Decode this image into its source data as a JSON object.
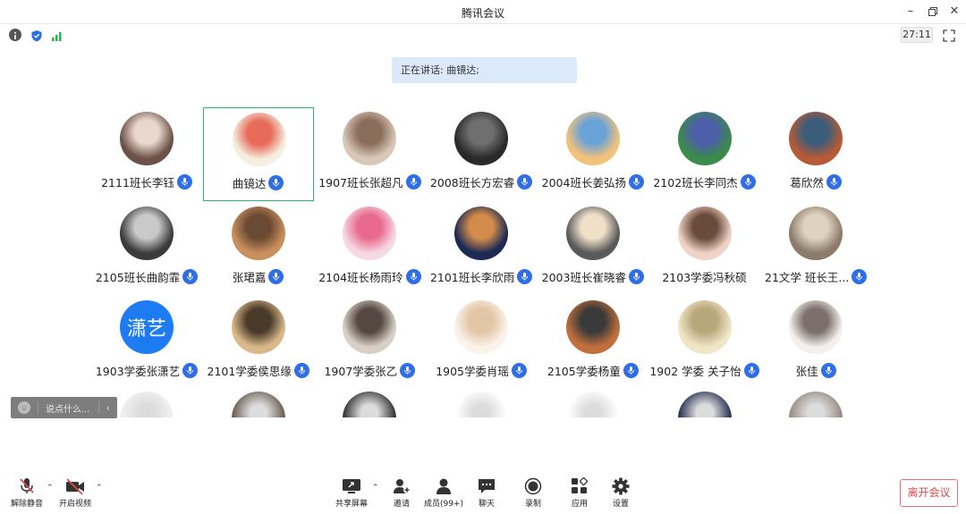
{
  "window": {
    "title": "腾讯会议",
    "minimize_icon": "minimize-icon",
    "restore_icon": "restore-icon",
    "close_icon": "close-icon"
  },
  "infobar": {
    "timer": "27:11",
    "icons": [
      "info-icon",
      "shield-icon",
      "signal-icon",
      "fullscreen-icon"
    ]
  },
  "speaking": {
    "text": "正在讲话: 曲镜达;"
  },
  "participants": [
    {
      "name": "2111班长李钰",
      "mic": true
    },
    {
      "name": "曲镜达",
      "mic": true,
      "active": true
    },
    {
      "name": "1907班长张超凡",
      "mic": true
    },
    {
      "name": "2008班长方宏睿",
      "mic": true
    },
    {
      "name": "2004班长姜弘扬",
      "mic": true
    },
    {
      "name": "2102班长李同杰",
      "mic": true
    },
    {
      "name": "葛欣然",
      "mic": true
    },
    {
      "name": "2105班长曲韵霏",
      "mic": true
    },
    {
      "name": "张珺嘉",
      "mic": true
    },
    {
      "name": "2104班长杨雨玲",
      "mic": true
    },
    {
      "name": "2101班长李欣雨",
      "mic": true
    },
    {
      "name": "2003班长崔晓睿",
      "mic": true
    },
    {
      "name": "2103学委冯秋硕",
      "mic": false
    },
    {
      "name": "21文学 班长王...",
      "mic": true
    },
    {
      "name": "1903学委张潇艺",
      "mic": true,
      "avatar_text": "潇艺"
    },
    {
      "name": "2101学委侯思缘",
      "mic": true
    },
    {
      "name": "1907学委张乙",
      "mic": true
    },
    {
      "name": "1905学委肖瑶",
      "mic": true
    },
    {
      "name": "2105学委杨童",
      "mic": true
    },
    {
      "name": "1902 学委 关子怡",
      "mic": true
    },
    {
      "name": "张佳",
      "mic": true
    }
  ],
  "colors": {
    "accent": "#2e6ee8",
    "active_border": "#2bb673",
    "leave": "#e04848"
  },
  "chat": {
    "placeholder": "说点什么..."
  },
  "toolbar": {
    "mute": "解除静音",
    "video": "开启视频",
    "share": "共享屏幕",
    "invite": "邀请",
    "members": "成员(99+)",
    "chat": "聊天",
    "record": "录制",
    "apps": "应用",
    "settings": "设置",
    "leave": "离开会议"
  }
}
